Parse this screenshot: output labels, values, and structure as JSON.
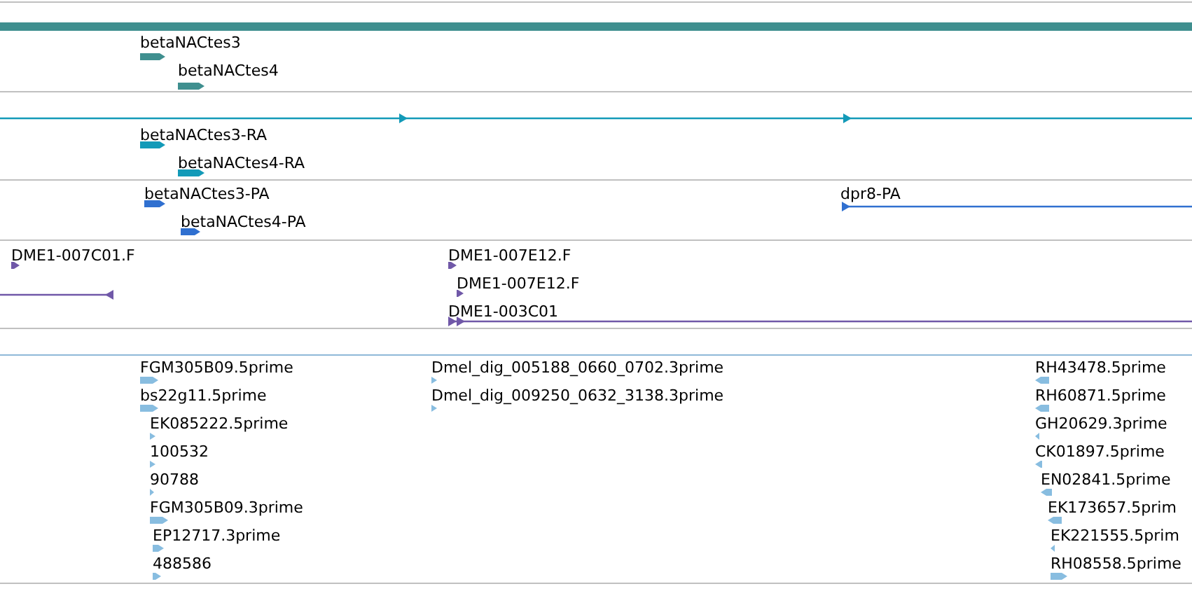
{
  "tracks": [
    {
      "kind": "bar",
      "color": "#3f8f8f"
    },
    {
      "kind": "genes",
      "color": "#3f8f8f",
      "features": [
        {
          "label": "betaNACtes3",
          "reverse": false
        },
        {
          "label": "betaNACtes4",
          "reverse": false
        }
      ]
    },
    {
      "kind": "genes",
      "color": "#139ab8",
      "features": [
        {
          "reverse": false
        },
        {
          "label": "betaNACtes3-RA",
          "reverse": false
        },
        {
          "label": "betaNACtes4-RA",
          "reverse": false
        }
      ]
    },
    {
      "kind": "genes",
      "color": "#3070d0",
      "features": [
        {
          "label": "betaNACtes3-PA",
          "reverse": false
        },
        {
          "label": "betaNACtes4-PA",
          "reverse": false
        },
        {
          "label": "dpr8-PA",
          "reverse": false
        }
      ]
    },
    {
      "kind": "genes",
      "color": "#7058a8",
      "features": [
        {
          "label": "DME1-007C01.F",
          "reverse": false
        },
        {
          "reverse": true
        },
        {
          "label": "DME1-007E12.F",
          "reverse": false
        },
        {
          "label": "DME1-007E12.F",
          "reverse": false
        },
        {
          "label": "DME1-003C01",
          "reverse": false
        }
      ]
    },
    {
      "kind": "empty"
    },
    {
      "kind": "genes",
      "color": "#88bde0",
      "features": [
        {
          "label": "FGM305B09.5prime",
          "reverse": false
        },
        {
          "label": "bs22g11.5prime",
          "reverse": false
        },
        {
          "label": "EK085222.5prime",
          "reverse": false
        },
        {
          "label": "100532",
          "reverse": false
        },
        {
          "label": "90788",
          "reverse": false
        },
        {
          "label": "FGM305B09.3prime",
          "reverse": false
        },
        {
          "label": "EP12717.3prime",
          "reverse": false
        },
        {
          "label": "488586",
          "reverse": false
        },
        {
          "label": "Dmel_dig_005188_0660_0702.3prime",
          "reverse": false
        },
        {
          "label": "Dmel_dig_009250_0632_3138.3prime",
          "reverse": false
        },
        {
          "label": "RH43478.5prime",
          "reverse": true
        },
        {
          "label": "RH60871.5prime",
          "reverse": true
        },
        {
          "label": "GH20629.3prime",
          "reverse": true
        },
        {
          "label": "CK01897.5prime",
          "reverse": true
        },
        {
          "label": "EN02841.5prime",
          "reverse": true
        },
        {
          "label": "EK173657.5prim",
          "reverse": true
        },
        {
          "label": "EK221555.5prim",
          "reverse": true
        },
        {
          "label": "RH08558.5prime",
          "reverse": false
        }
      ]
    }
  ]
}
